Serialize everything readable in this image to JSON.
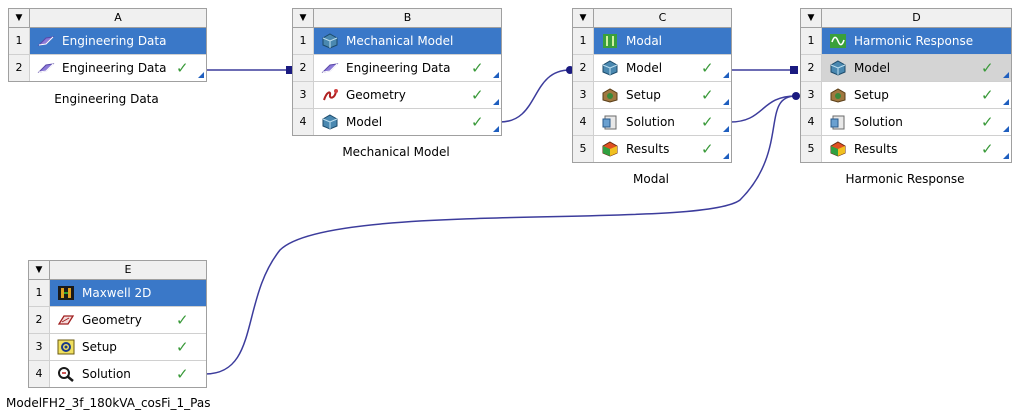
{
  "systems": {
    "A": {
      "letter": "A",
      "caption": "Engineering Data",
      "rows": [
        {
          "num": "1",
          "label": "Engineering Data"
        },
        {
          "num": "2",
          "label": "Engineering Data"
        }
      ]
    },
    "B": {
      "letter": "B",
      "caption": "Mechanical Model",
      "rows": [
        {
          "num": "1",
          "label": "Mechanical Model"
        },
        {
          "num": "2",
          "label": "Engineering Data"
        },
        {
          "num": "3",
          "label": "Geometry"
        },
        {
          "num": "4",
          "label": "Model"
        }
      ]
    },
    "C": {
      "letter": "C",
      "caption": "Modal",
      "rows": [
        {
          "num": "1",
          "label": "Modal"
        },
        {
          "num": "2",
          "label": "Model"
        },
        {
          "num": "3",
          "label": "Setup"
        },
        {
          "num": "4",
          "label": "Solution"
        },
        {
          "num": "5",
          "label": "Results"
        }
      ]
    },
    "D": {
      "letter": "D",
      "caption": "Harmonic Response",
      "rows": [
        {
          "num": "1",
          "label": "Harmonic Response"
        },
        {
          "num": "2",
          "label": "Model"
        },
        {
          "num": "3",
          "label": "Setup"
        },
        {
          "num": "4",
          "label": "Solution"
        },
        {
          "num": "5",
          "label": "Results"
        }
      ]
    },
    "E": {
      "letter": "E",
      "caption": "ModelFH2_3f_180kVA_cosFi_1_Pas",
      "rows": [
        {
          "num": "1",
          "label": "Maxwell 2D"
        },
        {
          "num": "2",
          "label": "Geometry"
        },
        {
          "num": "3",
          "label": "Setup"
        },
        {
          "num": "4",
          "label": "Solution"
        }
      ]
    }
  },
  "colors": {
    "title_row": "#3a78c8",
    "link_line": "#3c3c9c",
    "check": "#3a9a3a",
    "update_triangle": "#1f5fbf"
  },
  "icons": {
    "engineering-data": "book-icon",
    "mechanical-model": "model-cube-icon",
    "geometry": "geometry-icon",
    "modal": "modal-icon",
    "harmonic": "harmonic-wave-icon",
    "setup": "setup-icon",
    "solution": "solution-icon",
    "results": "results-icon",
    "maxwell": "maxwell-icon"
  }
}
